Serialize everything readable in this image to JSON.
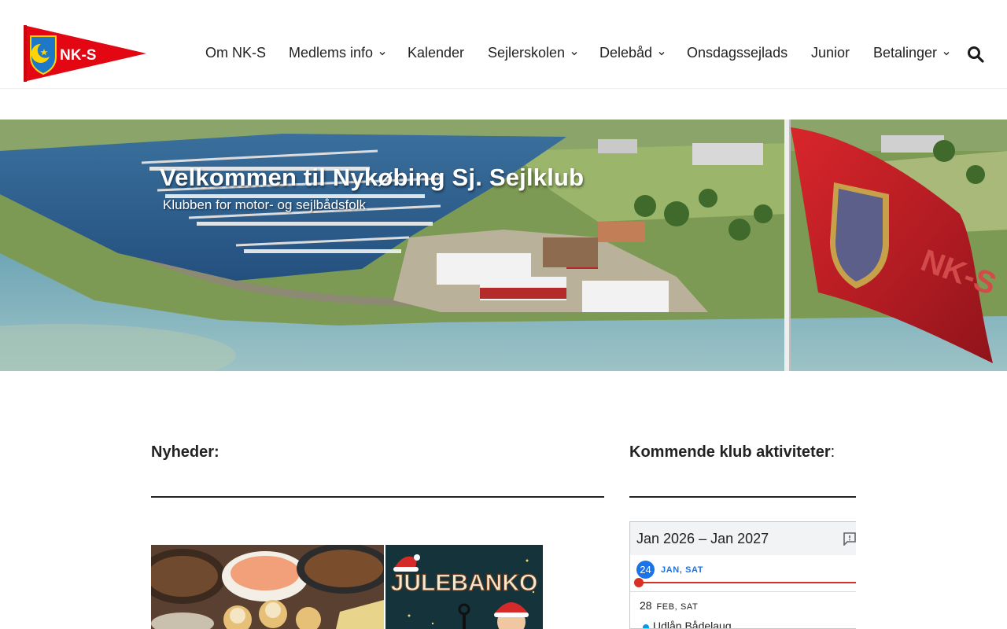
{
  "header": {
    "logo_text": "NK-S",
    "nav": [
      {
        "label": "Om NK-S",
        "dropdown": false
      },
      {
        "label": "Medlems info",
        "dropdown": true
      },
      {
        "label": "Kalender",
        "dropdown": false
      },
      {
        "label": "Sejlerskolen",
        "dropdown": true
      },
      {
        "label": "Delebåd",
        "dropdown": true
      },
      {
        "label": "Onsdagssejlads",
        "dropdown": false
      },
      {
        "label": "Junior",
        "dropdown": false
      },
      {
        "label": "Betalinger",
        "dropdown": true
      }
    ],
    "search_icon": "search-icon"
  },
  "hero": {
    "title": "Velkommen til Nykøbing Sj. Sejlklub",
    "subtitle": "Klubben for motor- og sejlbådsfolk",
    "flag_text": "NK-S"
  },
  "news": {
    "title": "Nyheder:",
    "cards": [
      {
        "alt": "food-platter-image"
      },
      {
        "caption": "JULEBANKO"
      }
    ]
  },
  "activities": {
    "title": "Kommende klub aktiviteter",
    "colon": ":"
  },
  "calendar": {
    "range": "Jan 2026 – Jan 2027",
    "today_day": "24",
    "today_label": "JAN, SAT",
    "event_day": "28",
    "event_month": "FEB, SAT",
    "event_title": "Udlån Bådelaug"
  },
  "colors": {
    "brand_red": "#e30613",
    "accent_blue": "#1a73e8",
    "now_red": "#d93025"
  }
}
